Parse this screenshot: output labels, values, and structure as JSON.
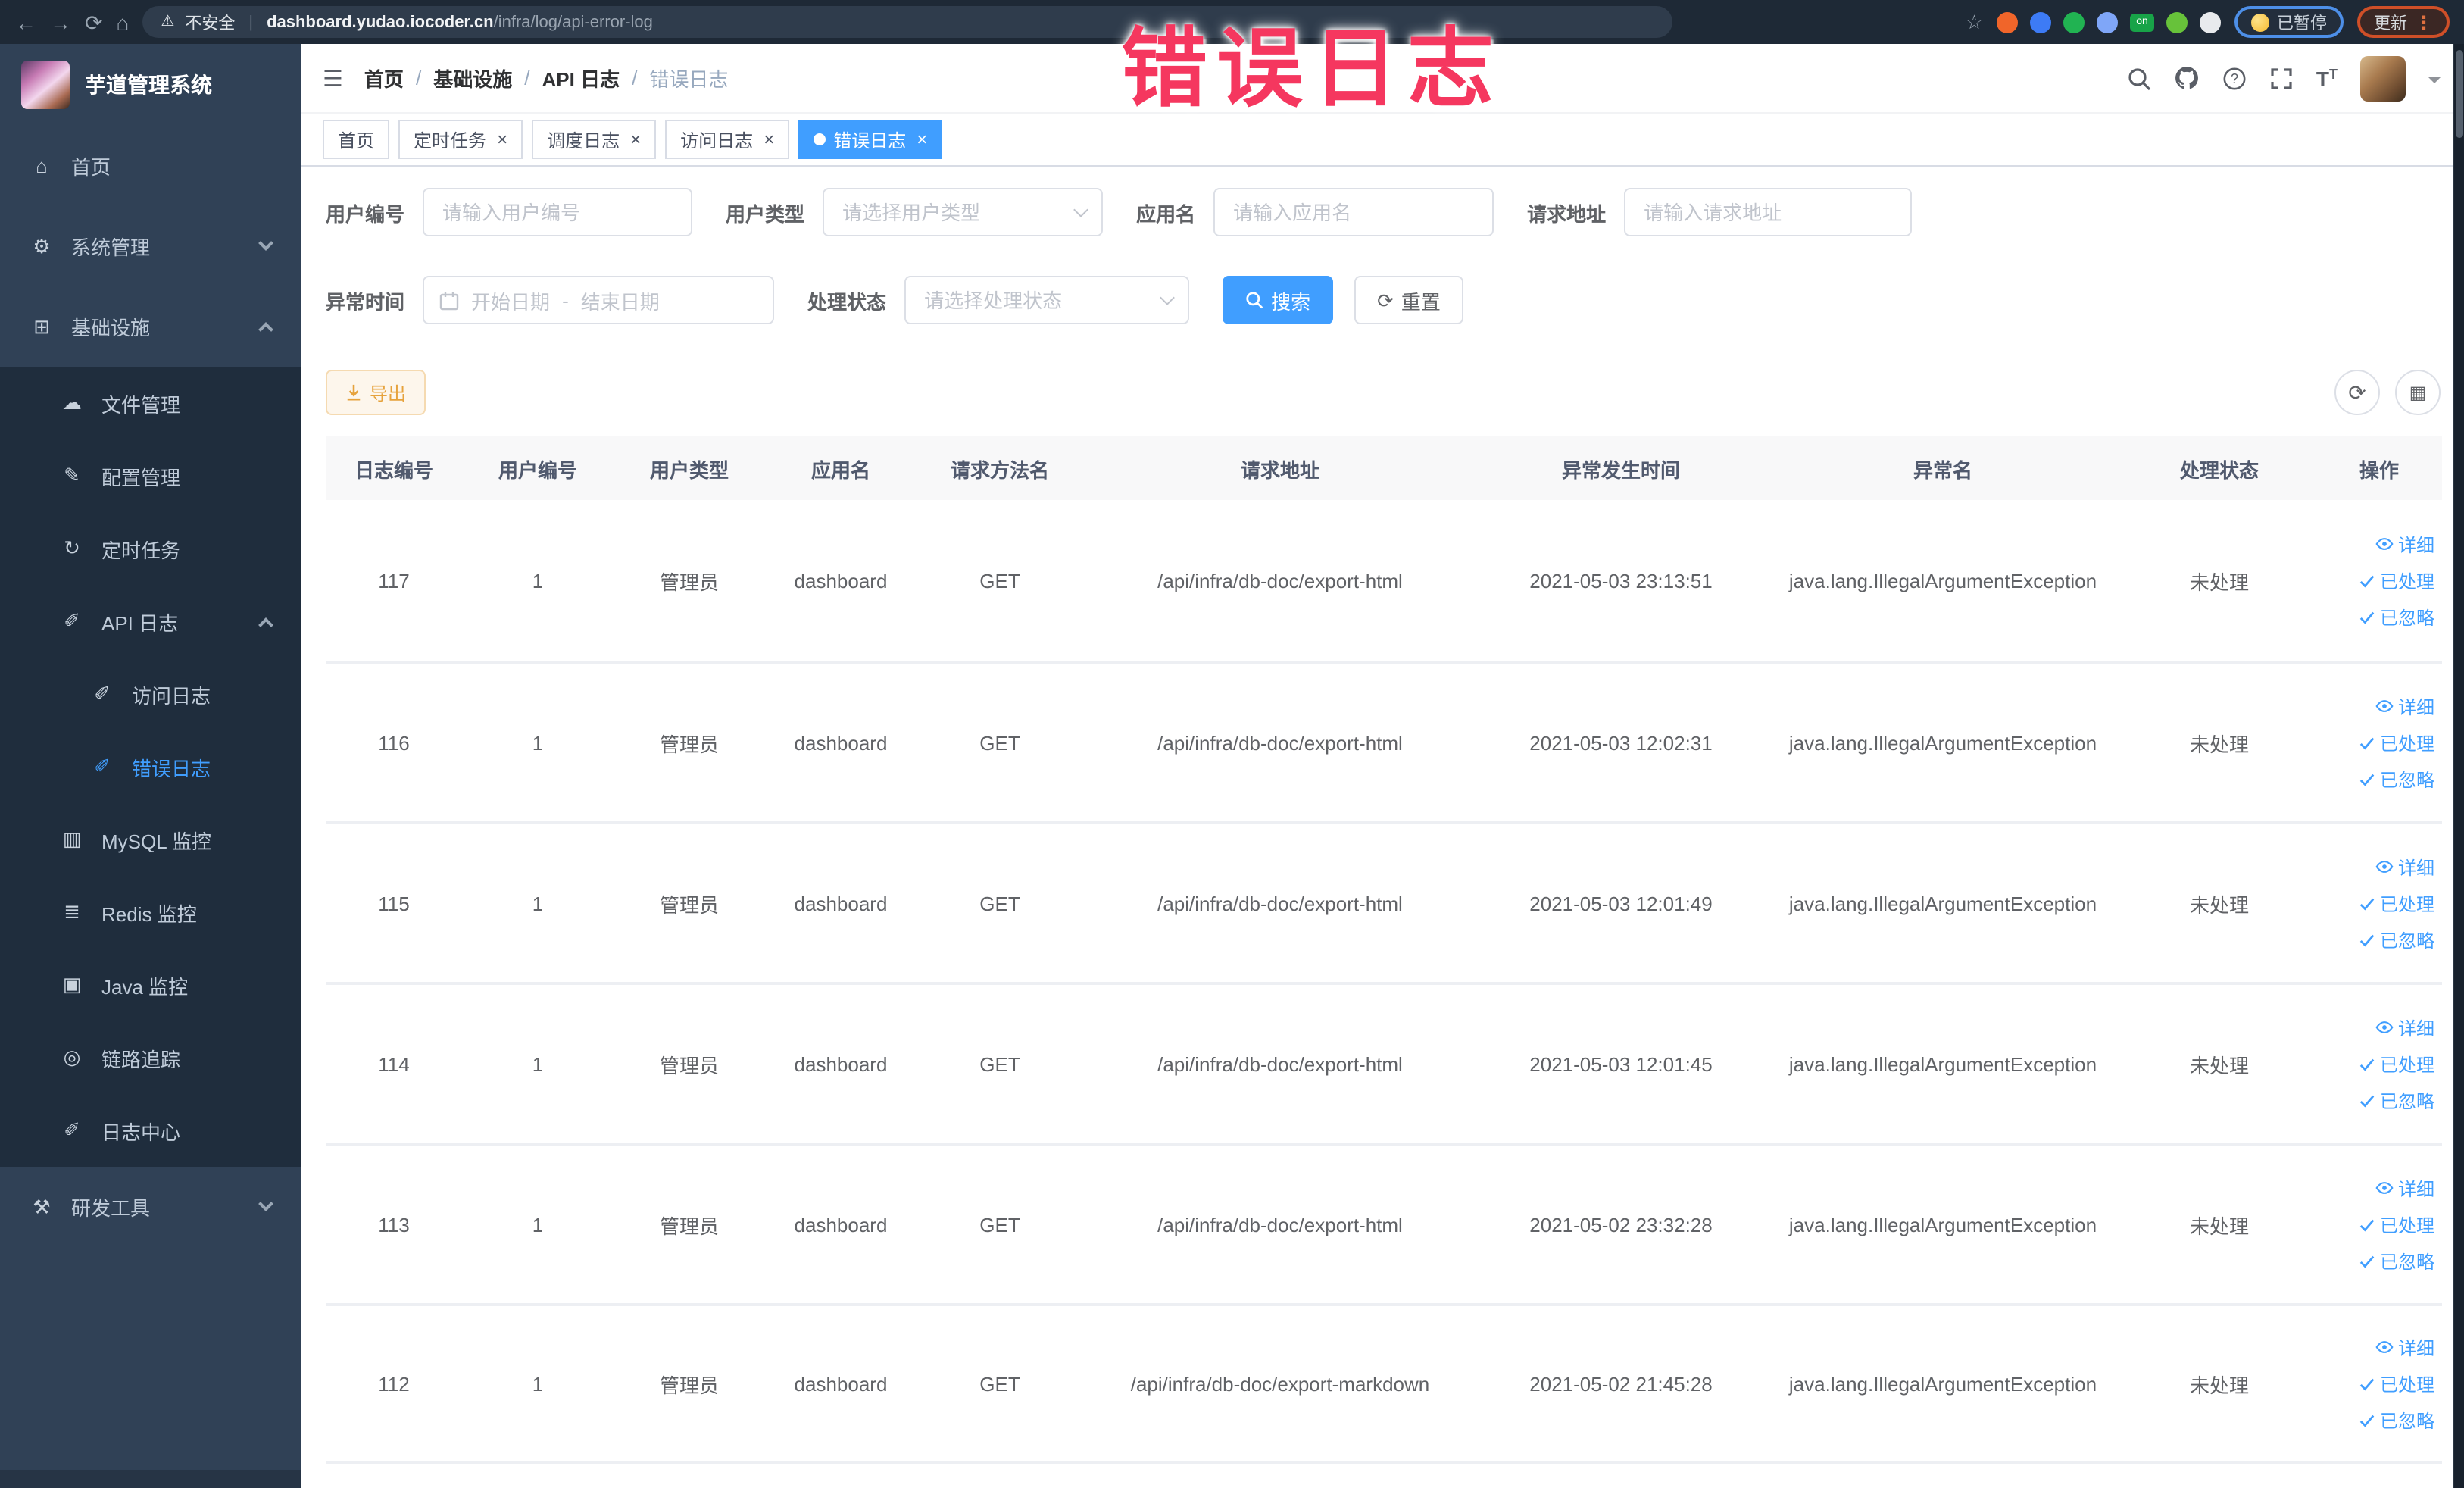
{
  "annotation": {
    "text": "错误日志",
    "color": "#f5375f"
  },
  "browser": {
    "security_label": "不安全",
    "url_host": "dashboard.yudao.iocoder.cn",
    "url_path": "/infra/log/api-error-log",
    "extensions": [
      {
        "name": "adblock-icon",
        "color": "#f0652a"
      },
      {
        "name": "shield-icon",
        "color": "#3d7bf5"
      },
      {
        "name": "green-check-icon",
        "color": "#21b352"
      },
      {
        "name": "grid-extension-icon",
        "color": "#7fa6f8"
      },
      {
        "name": "switch-on-icon",
        "color": "#18a348"
      },
      {
        "name": "leaf-icon",
        "color": "#67c23a"
      },
      {
        "name": "puzzle-icon",
        "color": "#e8eaed"
      }
    ],
    "paused_badge": "已暂停",
    "update_badge": "更新"
  },
  "sidebar": {
    "logo_title": "芋道管理系统",
    "items": [
      {
        "label": "首页",
        "icon": "home-icon",
        "level": 0,
        "expand": null,
        "active": false
      },
      {
        "label": "系统管理",
        "icon": "gear-icon",
        "level": 0,
        "expand": "down",
        "active": false
      },
      {
        "label": "基础设施",
        "icon": "infra-icon",
        "level": 0,
        "expand": "up",
        "active": false
      },
      {
        "label": "文件管理",
        "icon": "cloud-upload-icon",
        "level": 1,
        "expand": null,
        "active": false
      },
      {
        "label": "配置管理",
        "icon": "edit-icon",
        "level": 1,
        "expand": null,
        "active": false
      },
      {
        "label": "定时任务",
        "icon": "history-icon",
        "level": 1,
        "expand": null,
        "active": false
      },
      {
        "label": "API 日志",
        "icon": "log-icon",
        "level": 1,
        "expand": "up",
        "active": false
      },
      {
        "label": "访问日志",
        "icon": "log-icon",
        "level": 2,
        "expand": null,
        "active": false
      },
      {
        "label": "错误日志",
        "icon": "log-icon",
        "level": 2,
        "expand": null,
        "active": true
      },
      {
        "label": "MySQL 监控",
        "icon": "chart-icon",
        "level": 1,
        "expand": null,
        "active": false
      },
      {
        "label": "Redis 监控",
        "icon": "layers-icon",
        "level": 1,
        "expand": null,
        "active": false
      },
      {
        "label": "Java 监控",
        "icon": "monitor-icon",
        "level": 1,
        "expand": null,
        "active": false
      },
      {
        "label": "链路追踪",
        "icon": "eye-icon",
        "level": 1,
        "expand": null,
        "active": false
      },
      {
        "label": "日志中心",
        "icon": "log-icon",
        "level": 1,
        "expand": null,
        "active": false
      },
      {
        "label": "研发工具",
        "icon": "toolbox-icon",
        "level": 0,
        "expand": "down",
        "active": false
      }
    ]
  },
  "header": {
    "breadcrumb": {
      "items": [
        "首页",
        "基础设施",
        "API 日志",
        "错误日志"
      ],
      "separator": "/"
    },
    "icons": [
      "search-icon",
      "github-icon",
      "help-icon",
      "fullscreen-icon",
      "font-size-icon"
    ]
  },
  "tabs": [
    {
      "label": "首页",
      "active": false,
      "closable": false
    },
    {
      "label": "定时任务",
      "active": false,
      "closable": true
    },
    {
      "label": "调度日志",
      "active": false,
      "closable": true
    },
    {
      "label": "访问日志",
      "active": false,
      "closable": true
    },
    {
      "label": "错误日志",
      "active": true,
      "closable": true
    }
  ],
  "filters": {
    "user_id": {
      "label": "用户编号",
      "placeholder": "请输入用户编号"
    },
    "user_type": {
      "label": "用户类型",
      "placeholder": "请选择用户类型"
    },
    "app_name": {
      "label": "应用名",
      "placeholder": "请输入应用名"
    },
    "request_url": {
      "label": "请求地址",
      "placeholder": "请输入请求地址"
    },
    "exception_time": {
      "label": "异常时间",
      "start_placeholder": "开始日期",
      "separator": "-",
      "end_placeholder": "结束日期"
    },
    "process_status": {
      "label": "处理状态",
      "placeholder": "请选择处理状态"
    },
    "search_label": "搜索",
    "reset_label": "重置"
  },
  "toolbar": {
    "export_label": "导出",
    "icon_buttons": [
      "refresh-icon",
      "columns-icon"
    ]
  },
  "table": {
    "columns": [
      "日志编号",
      "用户编号",
      "用户类型",
      "应用名",
      "请求方法名",
      "请求地址",
      "异常发生时间",
      "异常名",
      "处理状态",
      "操作"
    ],
    "actions": [
      "详细",
      "已处理",
      "已忽略"
    ],
    "rows": [
      {
        "id": "117",
        "user_id": "1",
        "user_type": "管理员",
        "app": "dashboard",
        "method": "GET",
        "url": "/api/infra/db-doc/export-html",
        "time": "2021-05-03 23:13:51",
        "exception": "java.lang.IllegalArgumentException",
        "status": "未处理"
      },
      {
        "id": "116",
        "user_id": "1",
        "user_type": "管理员",
        "app": "dashboard",
        "method": "GET",
        "url": "/api/infra/db-doc/export-html",
        "time": "2021-05-03 12:02:31",
        "exception": "java.lang.IllegalArgumentException",
        "status": "未处理"
      },
      {
        "id": "115",
        "user_id": "1",
        "user_type": "管理员",
        "app": "dashboard",
        "method": "GET",
        "url": "/api/infra/db-doc/export-html",
        "time": "2021-05-03 12:01:49",
        "exception": "java.lang.IllegalArgumentException",
        "status": "未处理"
      },
      {
        "id": "114",
        "user_id": "1",
        "user_type": "管理员",
        "app": "dashboard",
        "method": "GET",
        "url": "/api/infra/db-doc/export-html",
        "time": "2021-05-03 12:01:45",
        "exception": "java.lang.IllegalArgumentException",
        "status": "未处理"
      },
      {
        "id": "113",
        "user_id": "1",
        "user_type": "管理员",
        "app": "dashboard",
        "method": "GET",
        "url": "/api/infra/db-doc/export-html",
        "time": "2021-05-02 23:32:28",
        "exception": "java.lang.IllegalArgumentException",
        "status": "未处理"
      },
      {
        "id": "112",
        "user_id": "1",
        "user_type": "管理员",
        "app": "dashboard",
        "method": "GET",
        "url": "/api/infra/db-doc/export-markdown",
        "time": "2021-05-02 21:45:28",
        "exception": "java.lang.IllegalArgumentException",
        "status": "未处理"
      }
    ]
  }
}
